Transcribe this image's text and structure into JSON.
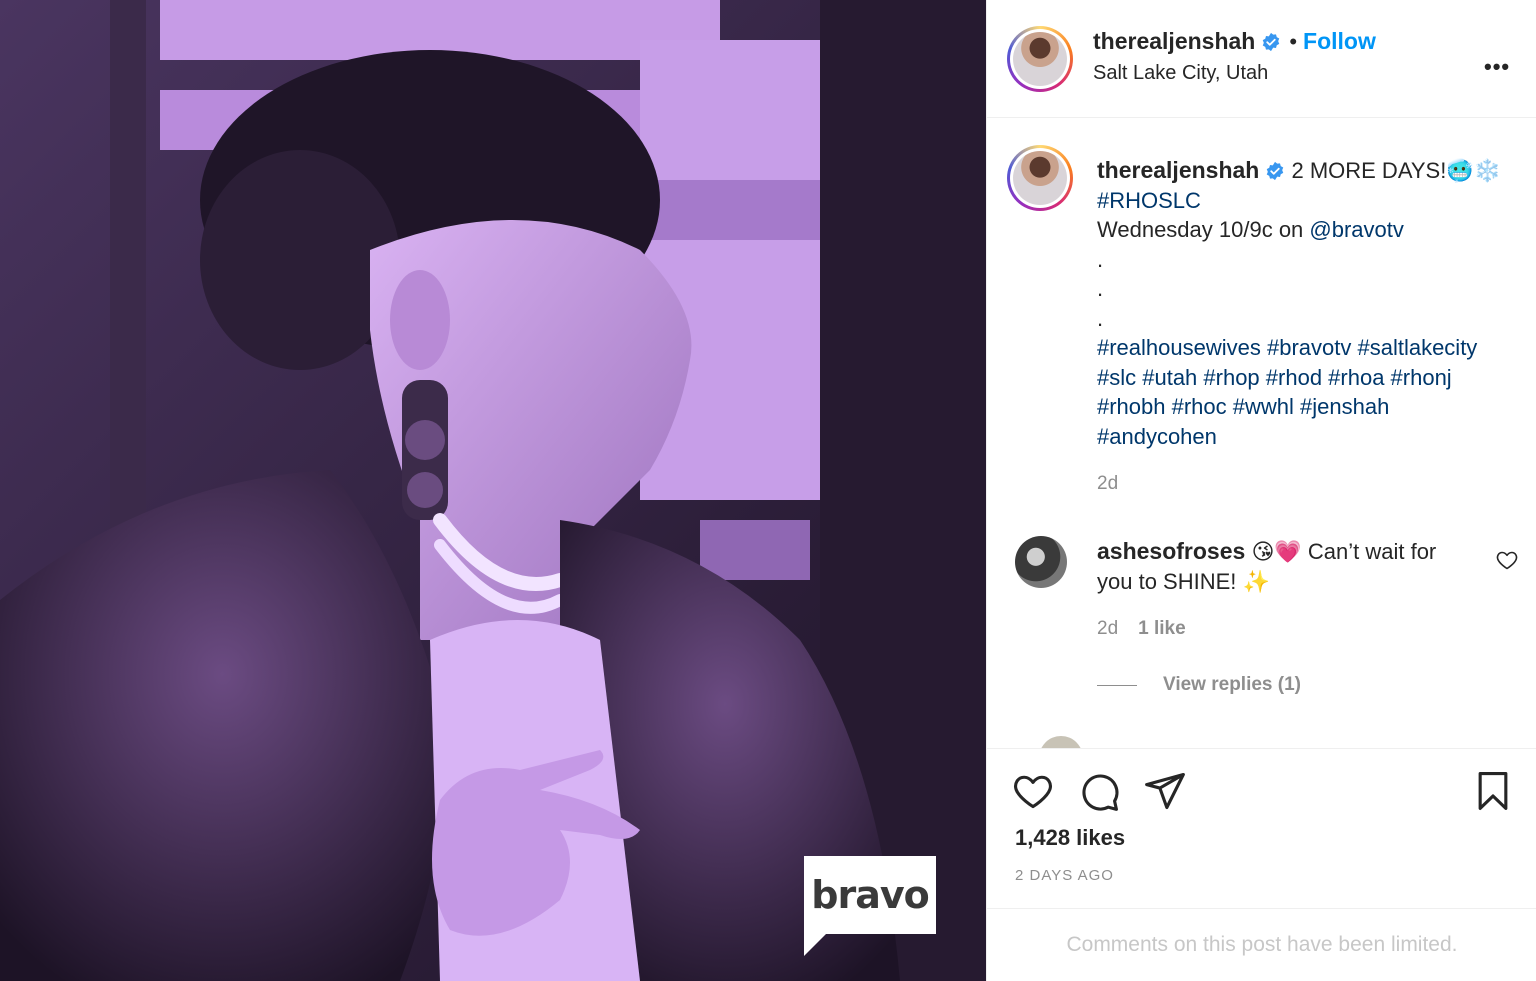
{
  "post": {
    "username": "therealjenshah",
    "follow_label": "Follow",
    "separator": "•",
    "location": "Salt Lake City, Utah",
    "more_label": "•••"
  },
  "caption": {
    "username": "therealjenshah",
    "line1": "2 MORE DAYS!🥶❄️",
    "line2": "#RHOSLC",
    "line3_prefix": "Wednesday 10/9c on ",
    "line3_mention": "@bravotv",
    "dots": [
      ".",
      ".",
      "."
    ],
    "hashtags_line1": "#realhousewives #bravotv #saltlakecity",
    "hashtags_line2": "#slc #utah #rhop #rhod #rhoa #rhonj",
    "hashtags_line3": "#rhobh #rhoc #wwhl #jenshah",
    "hashtags_line4": "#andycohen",
    "time": "2d"
  },
  "comment": {
    "username": "ashesofroses",
    "text_line1": "😘💗 Can’t wait for",
    "text_line2": "you to SHINE! ✨",
    "time": "2d",
    "likes": "1 like",
    "view_replies": "View replies (1)"
  },
  "actions": {
    "likes": "1,428 likes",
    "posted": "2 DAYS AGO"
  },
  "footer": {
    "limited": "Comments on this post have been limited."
  },
  "media": {
    "logo_text": "bravo"
  },
  "colors": {
    "link": "#00376b",
    "follow": "#0095f6",
    "muted": "#8e8e8e",
    "media_tint": "#c9a0e8"
  }
}
